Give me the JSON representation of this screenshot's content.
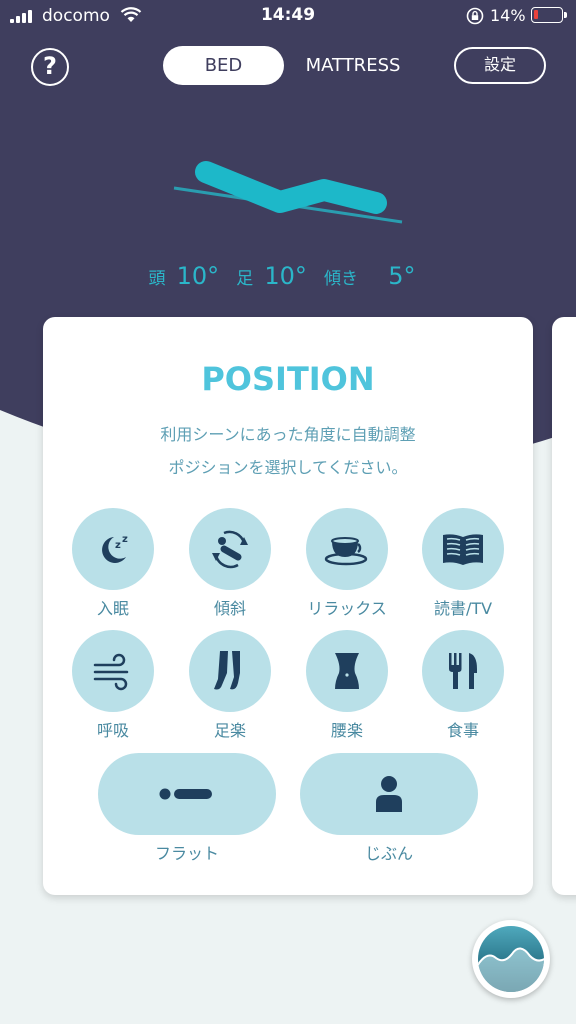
{
  "status_bar": {
    "carrier": "docomo",
    "time": "14:49",
    "battery": "14%",
    "battery_level": 0.14
  },
  "header": {
    "help": "?",
    "tabs": [
      {
        "label": "BED",
        "active": true
      },
      {
        "label": "MATTRESS",
        "active": false
      }
    ],
    "settings": "設定"
  },
  "bed": {
    "angles": [
      {
        "label": "頭",
        "value": "10°"
      },
      {
        "label": "足",
        "value": "10°"
      },
      {
        "label": "傾き",
        "value": "5°"
      }
    ]
  },
  "card": {
    "title": "POSITION",
    "desc1": "利用シーンにあった角度に自動調整",
    "desc2": "ポジションを選択してください。",
    "buttons": [
      {
        "label": "入眠",
        "icon": "moon-sleep-icon"
      },
      {
        "label": "傾斜",
        "icon": "tilt-rotate-icon"
      },
      {
        "label": "リラックス",
        "icon": "teacup-icon"
      },
      {
        "label": "読書/TV",
        "icon": "book-icon"
      },
      {
        "label": "呼吸",
        "icon": "wind-icon"
      },
      {
        "label": "足楽",
        "icon": "legs-icon"
      },
      {
        "label": "腰楽",
        "icon": "waist-icon"
      },
      {
        "label": "食事",
        "icon": "fork-knife-icon"
      }
    ],
    "pills": [
      {
        "label": "フラット",
        "icon": "flat-icon"
      },
      {
        "label": "じぶん",
        "icon": "person-icon"
      }
    ]
  },
  "colors": {
    "header_bg": "#3f3e5e",
    "accent": "#2bb6c9",
    "icon_dark": "#1f3f5d",
    "button_bg": "#b9e0e8"
  },
  "graph_icon": "graph-icon"
}
